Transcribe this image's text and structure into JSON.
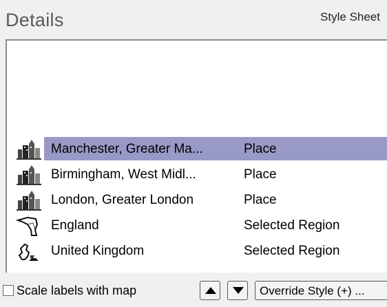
{
  "header": {
    "title": "Details",
    "style_sheet_label": "Style Sheet"
  },
  "list": {
    "rows": [
      {
        "name": "Manchester, Greater Ma...",
        "type": "Place",
        "icon": "city-buildings-icon",
        "selected": true
      },
      {
        "name": "Birmingham, West Midl...",
        "type": "Place",
        "icon": "city-buildings-icon",
        "selected": false
      },
      {
        "name": "London, Greater London",
        "type": "Place",
        "icon": "city-buildings-icon",
        "selected": false
      },
      {
        "name": "England",
        "type": "Selected Region",
        "icon": "region-map-icon",
        "selected": false
      },
      {
        "name": "United Kingdom",
        "type": "Selected Region",
        "icon": "country-map-icon",
        "selected": false
      }
    ]
  },
  "footer": {
    "scale_labels_text": "Scale labels with map",
    "scale_labels_checked": false,
    "override_style_label": "Override Style (+) ..."
  },
  "colors": {
    "selection": "#9999c8",
    "panel_bg": "#f0f0f0"
  }
}
